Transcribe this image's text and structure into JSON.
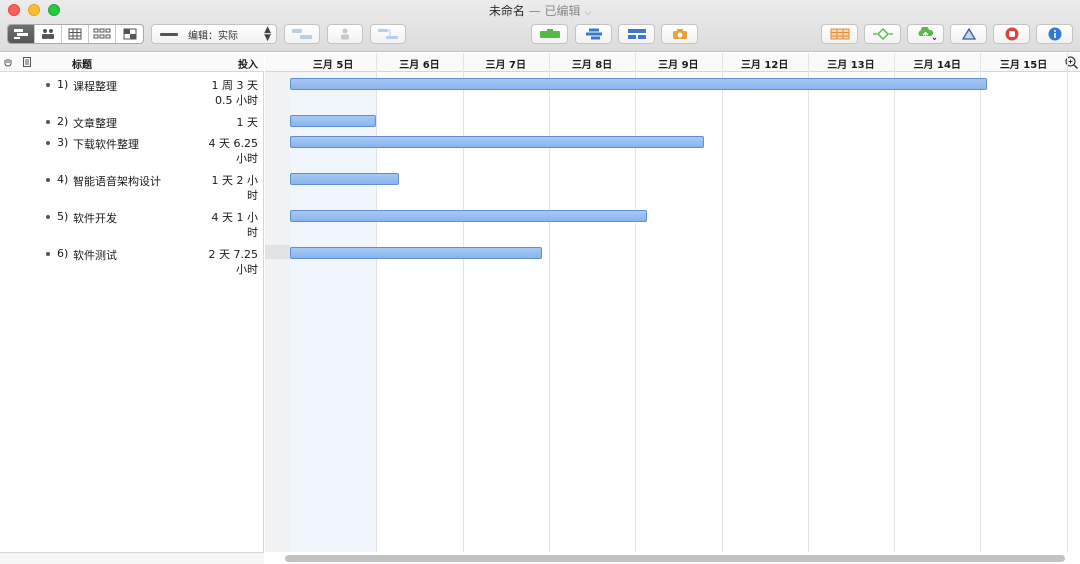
{
  "window": {
    "title": "未命名",
    "separator": "—",
    "status": "已编辑"
  },
  "toolbar": {
    "view_mode_label": "编辑：实际",
    "accent_green": "#57b847",
    "accent_blue": "#3b78c9",
    "accent_orange": "#e8883a",
    "accent_red": "#e0403a"
  },
  "outline": {
    "header_title": "标题",
    "header_effort": "投入",
    "tasks": [
      {
        "num": "1)",
        "name": "课程整理",
        "effort_line1": "1 周 3 天",
        "effort_line2": "0.5 小时"
      },
      {
        "num": "2)",
        "name": "文章整理",
        "effort_line1": "1 天",
        "effort_line2": ""
      },
      {
        "num": "3)",
        "name": "下载软件整理",
        "effort_line1": "4 天 6.25",
        "effort_line2": "小时"
      },
      {
        "num": "4)",
        "name": "智能语音架构设计",
        "effort_line1": "1 天 2 小",
        "effort_line2": "时"
      },
      {
        "num": "5)",
        "name": "软件开发",
        "effort_line1": "4 天 1 小",
        "effort_line2": "时"
      },
      {
        "num": "6)",
        "name": "软件测试",
        "effort_line1": "2 天 7.25",
        "effort_line2": "小时"
      }
    ]
  },
  "gantt": {
    "days": [
      "三月 5日",
      "三月 6日",
      "三月 7日",
      "三月 8日",
      "三月 9日",
      "三月 12日",
      "三月 13日",
      "三月 14日",
      "三月 15日"
    ],
    "bar_color": "#9bbff2",
    "bars_in_days": [
      8.08,
      1.0,
      4.8,
      1.26,
      4.14,
      2.92
    ]
  }
}
